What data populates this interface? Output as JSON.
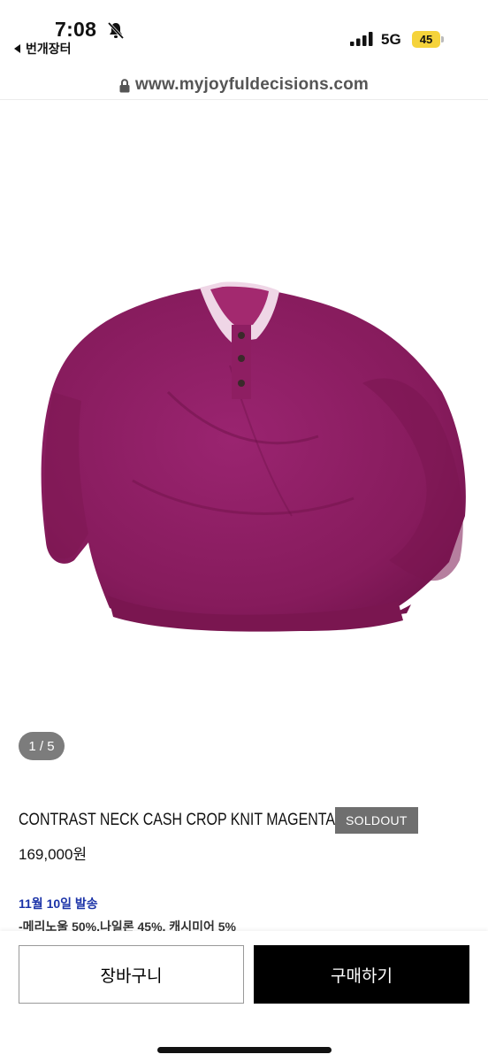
{
  "status_bar": {
    "time": "7:08",
    "back_app_label": "번개장터",
    "network": "5G",
    "battery_level": "45",
    "icons": [
      "bell-slash-icon",
      "signal-icon",
      "battery-icon"
    ]
  },
  "browser": {
    "url": "www.myjoyfuldecisions.com",
    "lock_icon": "lock-icon"
  },
  "product": {
    "image_alt": "magenta knit sweater",
    "image_colors": {
      "knit": "#8e1e62",
      "neck": "#efd6e6"
    },
    "pager": "1 / 5",
    "title": "CONTRAST NECK CASH CROP KNIT MAGENTA",
    "status_badge": "SOLDOUT",
    "price": "169,000원",
    "ship_date": "11월 10일 발송",
    "material": "-메리노울 50%,나일론 45%, 캐시미어 5%"
  },
  "actions": {
    "cart_label": "장바구니",
    "buy_label": "구매하기"
  }
}
